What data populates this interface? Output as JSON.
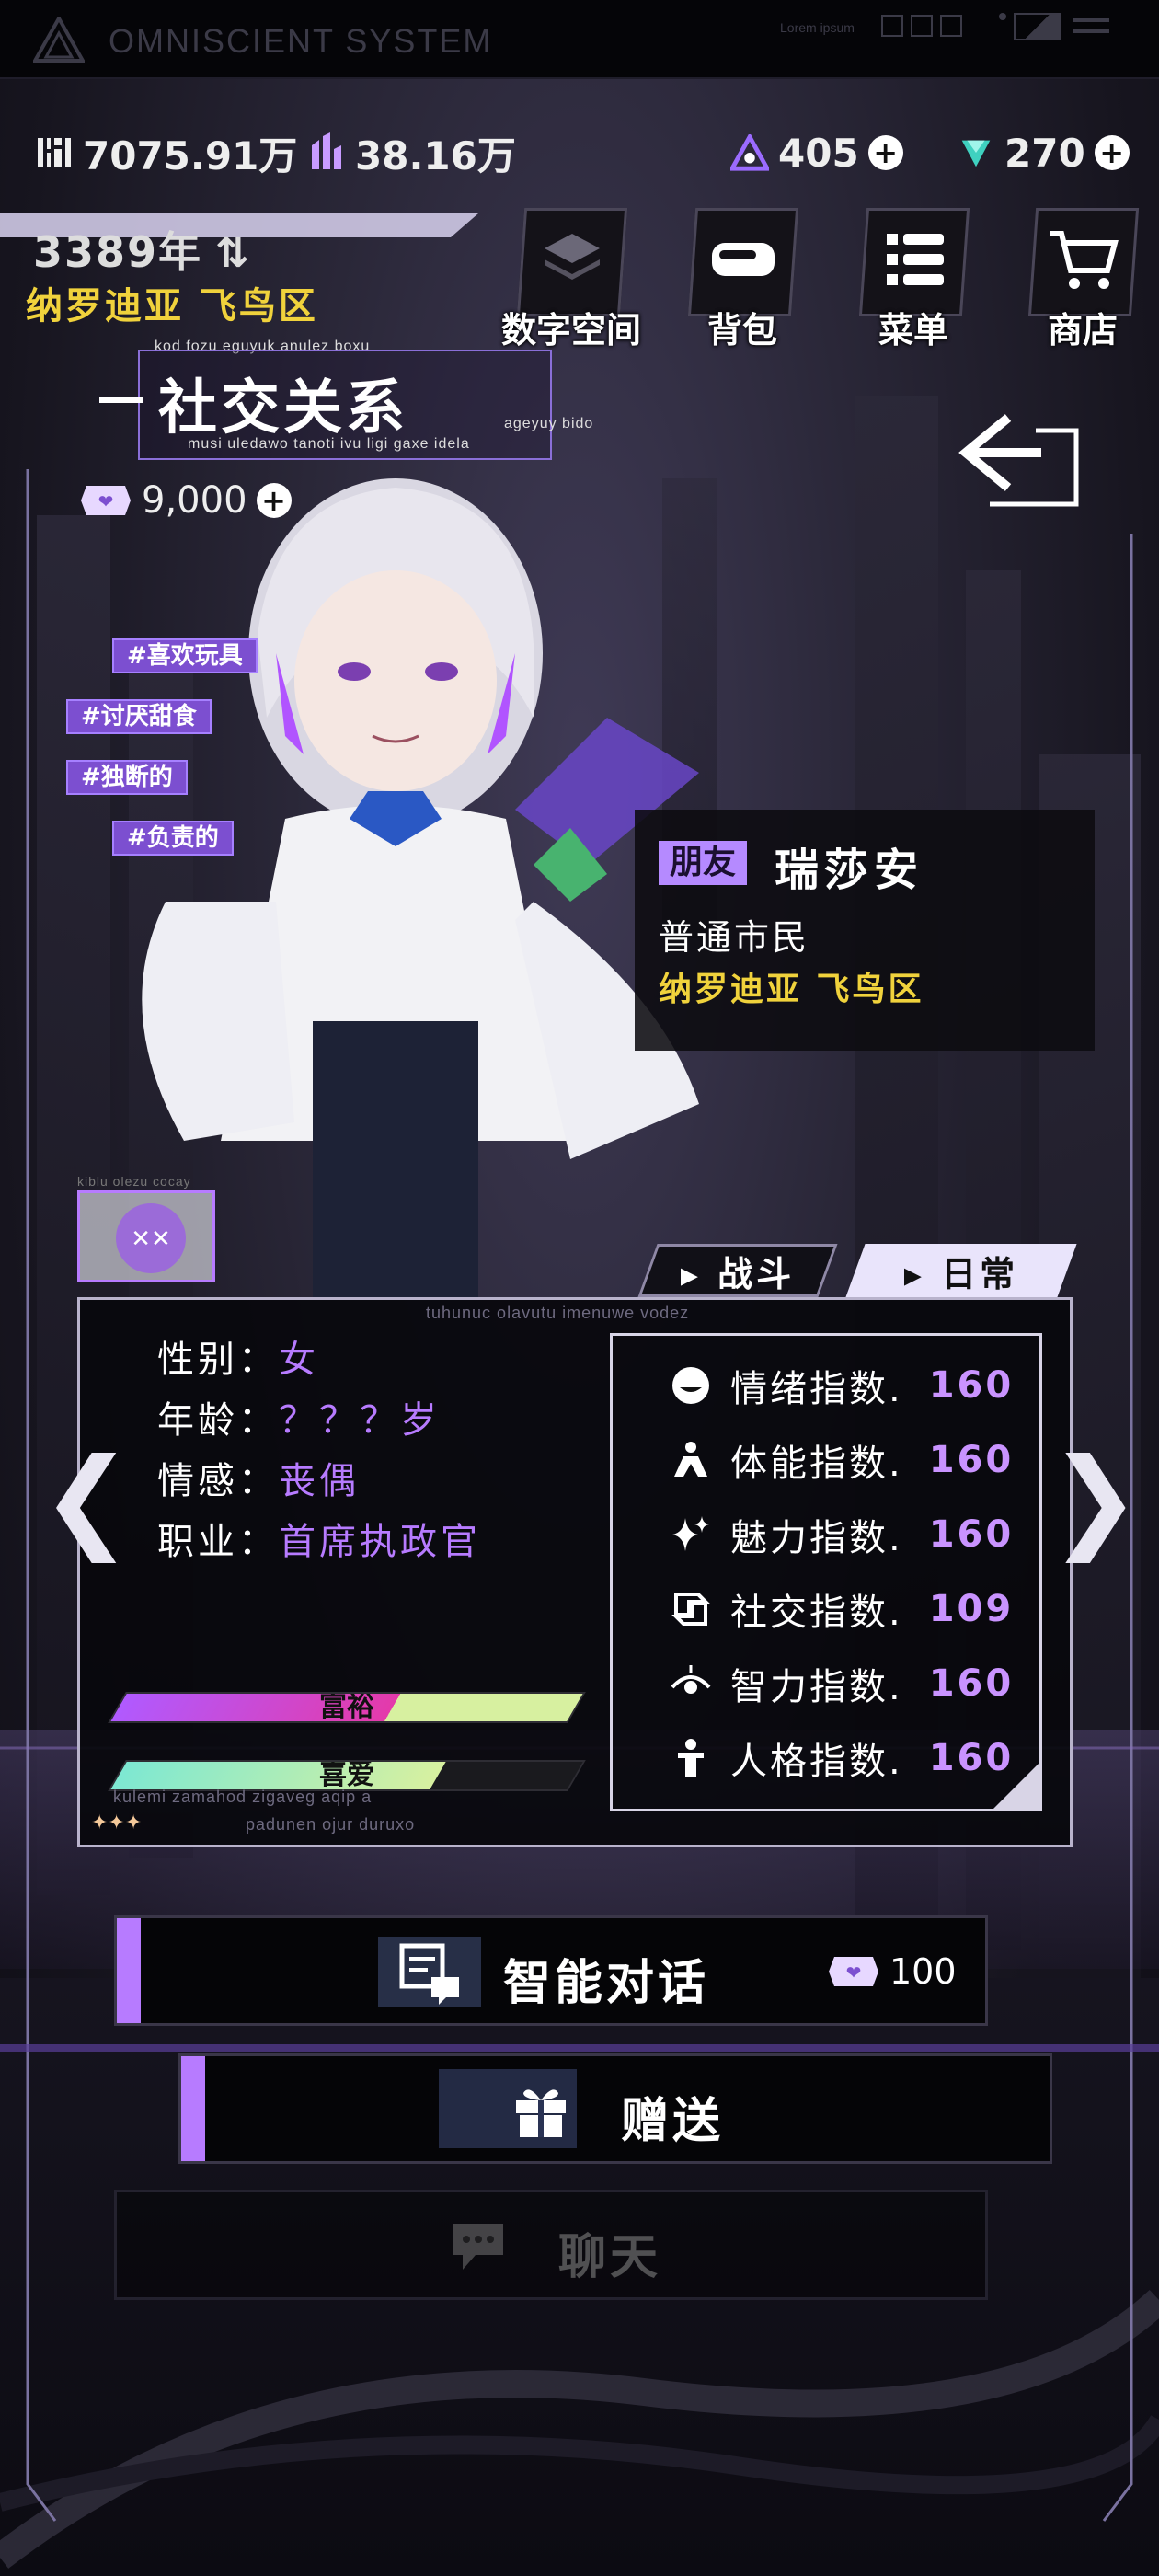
{
  "topbar": {
    "title": "OMNISCIENT  SYSTEM",
    "lorem": "Lorem ipsum"
  },
  "resources": {
    "money": "7075.91万",
    "points": "38.16万",
    "gem_a": "405",
    "gem_b": "270"
  },
  "header": {
    "year": "3389年",
    "location": "纳罗迪亚 飞鸟区"
  },
  "nav": {
    "items": [
      {
        "label": "数字空间",
        "icon": "layers-icon"
      },
      {
        "label": "背包",
        "icon": "bag-icon"
      },
      {
        "label": "菜单",
        "icon": "menu-list-icon"
      },
      {
        "label": "商店",
        "icon": "cart-icon"
      }
    ]
  },
  "page": {
    "title": "社交关系",
    "caption_top": "kod fozu eguyuk anulez boxu",
    "caption_right": "ageyuy bido",
    "caption_bottom": "musi uledawo tanoti ivu ligi gaxe idela",
    "currency": "9,000"
  },
  "tags": [
    "#喜欢玩具",
    "#讨厌甜食",
    "#独断的",
    "#负责的"
  ],
  "character": {
    "relation": "朋友",
    "name": "瑞莎安",
    "job": "普通市民",
    "location": "纳罗迪亚 飞鸟区",
    "badge_caption": "kiblu olezu cocay"
  },
  "tabs": {
    "battle": "战斗",
    "daily": "日常",
    "active": "daily"
  },
  "profile": {
    "caption": "tuhunuc olavutu imenuwe vodez",
    "fields": [
      {
        "key": "性别：",
        "value": "女"
      },
      {
        "key": "年龄：",
        "value": "？？？岁"
      },
      {
        "key": "情感：",
        "value": "丧偶"
      },
      {
        "key": "职业：",
        "value": "首席执政官"
      }
    ],
    "bars": [
      {
        "label": "富裕",
        "value": 0.6
      },
      {
        "label": "喜爱",
        "value": 0.7
      }
    ],
    "footer_caption_1": "kulemi zamahod zigaveg aqip a",
    "footer_caption_2": "padunen ojur duruxo"
  },
  "stats": [
    {
      "label": "情绪指数.",
      "value": "160",
      "icon": "mood-icon"
    },
    {
      "label": "体能指数.",
      "value": "160",
      "icon": "fitness-icon"
    },
    {
      "label": "魅力指数.",
      "value": "160",
      "icon": "charm-sparkle-icon"
    },
    {
      "label": "社交指数.",
      "value": "109",
      "icon": "social-icon"
    },
    {
      "label": "智力指数.",
      "value": "160",
      "icon": "eye-intellect-icon"
    },
    {
      "label": "人格指数.",
      "value": "160",
      "icon": "person-icon"
    }
  ],
  "actions": {
    "smart_chat": "智能对话",
    "smart_chat_cost": "100",
    "gift": "赠送",
    "chat": "聊天"
  },
  "colors": {
    "accent": "#b77bff",
    "gold": "#f0d23c",
    "tag_bg": "#7c4fd0"
  }
}
